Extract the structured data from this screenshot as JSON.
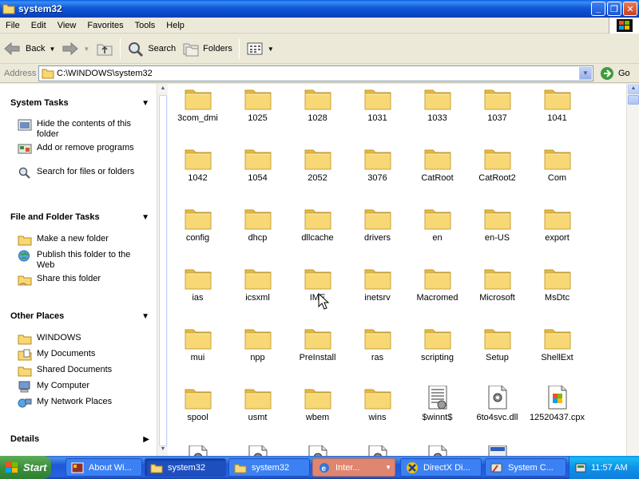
{
  "window": {
    "title": "system32",
    "menu": [
      "File",
      "Edit",
      "View",
      "Favorites",
      "Tools",
      "Help"
    ]
  },
  "toolbar": {
    "back_label": "Back",
    "search_label": "Search",
    "folders_label": "Folders"
  },
  "address": {
    "label": "Address",
    "path": "C:\\WINDOWS\\system32",
    "go_label": "Go"
  },
  "taskpane": {
    "system_tasks": {
      "title": "System Tasks",
      "items": [
        "Hide the contents of this folder",
        "Add or remove programs",
        "Search for files or folders"
      ]
    },
    "file_folder_tasks": {
      "title": "File and Folder Tasks",
      "items": [
        "Make a new folder",
        "Publish this folder to the Web",
        "Share this folder"
      ]
    },
    "other_places": {
      "title": "Other Places",
      "items": [
        "WINDOWS",
        "My Documents",
        "Shared Documents",
        "My Computer",
        "My Network Places"
      ]
    },
    "details": {
      "title": "Details"
    }
  },
  "files": [
    {
      "name": "3com_dmi",
      "type": "folder"
    },
    {
      "name": "1025",
      "type": "folder"
    },
    {
      "name": "1028",
      "type": "folder"
    },
    {
      "name": "1031",
      "type": "folder"
    },
    {
      "name": "1033",
      "type": "folder"
    },
    {
      "name": "1037",
      "type": "folder"
    },
    {
      "name": "1041",
      "type": "folder"
    },
    {
      "name": "1042",
      "type": "folder"
    },
    {
      "name": "1054",
      "type": "folder"
    },
    {
      "name": "2052",
      "type": "folder"
    },
    {
      "name": "3076",
      "type": "folder"
    },
    {
      "name": "CatRoot",
      "type": "folder"
    },
    {
      "name": "CatRoot2",
      "type": "folder"
    },
    {
      "name": "Com",
      "type": "folder"
    },
    {
      "name": "config",
      "type": "folder"
    },
    {
      "name": "dhcp",
      "type": "folder"
    },
    {
      "name": "dllcache",
      "type": "folder"
    },
    {
      "name": "drivers",
      "type": "folder"
    },
    {
      "name": "en",
      "type": "folder"
    },
    {
      "name": "en-US",
      "type": "folder"
    },
    {
      "name": "export",
      "type": "folder"
    },
    {
      "name": "ias",
      "type": "folder"
    },
    {
      "name": "icsxml",
      "type": "folder"
    },
    {
      "name": "IME",
      "type": "folder"
    },
    {
      "name": "inetsrv",
      "type": "folder"
    },
    {
      "name": "Macromed",
      "type": "folder"
    },
    {
      "name": "Microsoft",
      "type": "folder"
    },
    {
      "name": "MsDtc",
      "type": "folder"
    },
    {
      "name": "mui",
      "type": "folder"
    },
    {
      "name": "npp",
      "type": "folder"
    },
    {
      "name": "PreInstall",
      "type": "folder"
    },
    {
      "name": "ras",
      "type": "folder"
    },
    {
      "name": "scripting",
      "type": "folder"
    },
    {
      "name": "Setup",
      "type": "folder"
    },
    {
      "name": "ShellExt",
      "type": "folder"
    },
    {
      "name": "spool",
      "type": "folder"
    },
    {
      "name": "usmt",
      "type": "folder"
    },
    {
      "name": "wbem",
      "type": "folder"
    },
    {
      "name": "wins",
      "type": "folder"
    },
    {
      "name": "$winnt$",
      "type": "text"
    },
    {
      "name": "6to4svc.dll",
      "type": "dll"
    },
    {
      "name": "12520437.cpx",
      "type": "cpx"
    },
    {
      "name": "",
      "type": "dll"
    },
    {
      "name": "",
      "type": "dll"
    },
    {
      "name": "",
      "type": "dll"
    },
    {
      "name": "",
      "type": "dll"
    },
    {
      "name": "",
      "type": "dll"
    },
    {
      "name": "",
      "type": "app"
    }
  ],
  "taskbar": {
    "start_label": "Start",
    "buttons": [
      {
        "label": "About Wi...",
        "icon": "about-windows-icon"
      },
      {
        "label": "system32",
        "icon": "folder-icon",
        "active": true
      },
      {
        "label": "system32",
        "icon": "folder-icon"
      },
      {
        "label": "Inter...",
        "icon": "internet-explorer-icon"
      },
      {
        "label": "DirectX Di...",
        "icon": "directx-icon"
      },
      {
        "label": "System C...",
        "icon": "system-config-icon"
      }
    ],
    "clock": "11:57 AM"
  },
  "colors": {
    "titlebar": "#0A5FE0",
    "taskpane_gradient": "#7BA2E7",
    "folder_yellow": "#F8D775",
    "start_green": "#3C8F3E"
  }
}
